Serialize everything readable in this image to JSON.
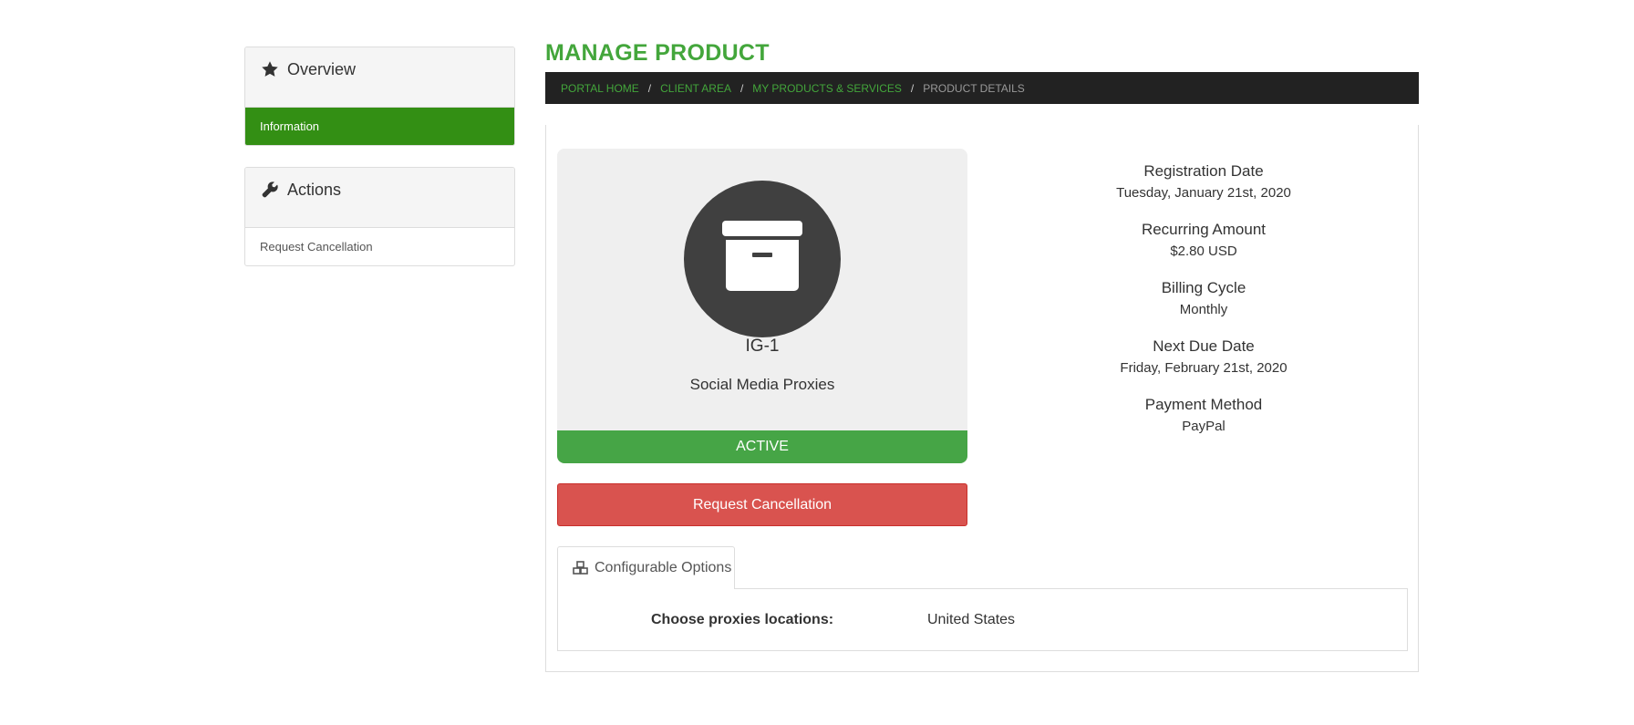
{
  "sidebar": {
    "overview": {
      "title": "Overview",
      "icon": "star-icon",
      "items": [
        {
          "label": "Information",
          "active": true
        }
      ]
    },
    "actions": {
      "title": "Actions",
      "icon": "wrench-icon",
      "items": [
        {
          "label": "Request Cancellation",
          "active": false
        }
      ]
    }
  },
  "header": {
    "title": "MANAGE PRODUCT",
    "breadcrumb": [
      "PORTAL HOME",
      "CLIENT AREA",
      "MY PRODUCTS & SERVICES",
      "PRODUCT DETAILS"
    ],
    "separator": "/"
  },
  "product": {
    "icon": "archive-box-icon",
    "name": "IG-1",
    "group": "Social Media Proxies",
    "status": "ACTIVE",
    "status_color": "#46a546"
  },
  "actions": {
    "request_cancellation_label": "Request Cancellation",
    "button_color": "#d9534f"
  },
  "details": [
    {
      "label": "Registration Date",
      "value": "Tuesday, January 21st, 2020"
    },
    {
      "label": "Recurring Amount",
      "value": "$2.80 USD"
    },
    {
      "label": "Billing Cycle",
      "value": "Monthly"
    },
    {
      "label": "Next Due Date",
      "value": "Friday, February 21st, 2020"
    },
    {
      "label": "Payment Method",
      "value": "PayPal"
    }
  ],
  "configurable_options": {
    "tab_label": "Configurable Options",
    "tab_icon": "cubes-icon",
    "options": [
      {
        "label": "Choose proxies locations:",
        "value": "United States"
      }
    ]
  },
  "colors": {
    "accent": "#43a63b",
    "active_nav": "#338f14",
    "breadcrumb_bg": "#222222"
  }
}
